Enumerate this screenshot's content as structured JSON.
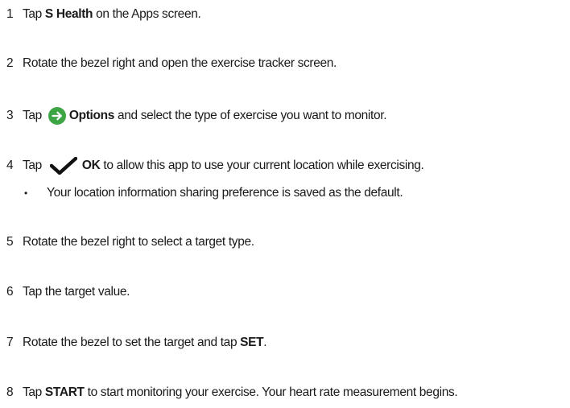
{
  "steps": [
    {
      "num": "1",
      "pre": "Tap ",
      "bold": "S Health",
      "post": " on the Apps screen."
    },
    {
      "num": "2",
      "text": "Rotate the bezel right and open the exercise tracker screen."
    },
    {
      "num": "3",
      "pre": "Tap ",
      "icon": "arrow-circle-icon",
      "bold": "Options",
      "post": " and select the type of exercise you want to monitor."
    },
    {
      "num": "4",
      "pre": "Tap ",
      "icon": "checkmark-icon",
      "bold": "OK",
      "post": " to allow this app to use your current location while exercising.",
      "sub": {
        "bullet": "•",
        "text": "Your location information sharing preference is saved as the default."
      }
    },
    {
      "num": "5",
      "text": "Rotate the bezel right to select a target type."
    },
    {
      "num": "6",
      "text": "Tap the target value."
    },
    {
      "num": "7",
      "pre": "Rotate the bezel to set the target and tap ",
      "bold": "SET",
      "post": "."
    },
    {
      "num": "8",
      "pre": "Tap ",
      "bold": "START",
      "post": " to start monitoring your exercise. Your heart rate measurement begins."
    }
  ],
  "colors": {
    "arrow_icon_bg": "#3ea545",
    "checkmark": "#111111",
    "text": "#1a1a1a"
  }
}
